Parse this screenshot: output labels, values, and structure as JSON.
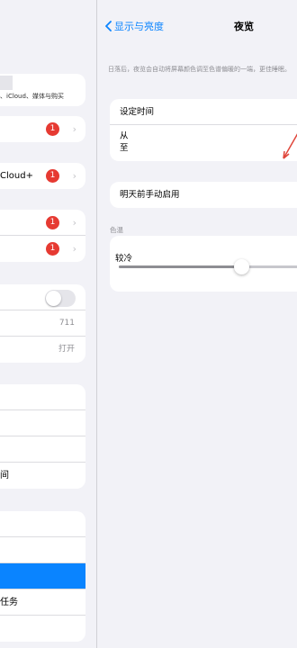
{
  "sidebar": {
    "profile_subtitle": "、iCloud、媒体与购买",
    "card2_rows": [
      {
        "label": "",
        "badge": "1"
      }
    ],
    "icloud_plus": {
      "label": "Cloud+",
      "badge": "1"
    },
    "update_rows": [
      {
        "label": "",
        "badge": "1"
      },
      {
        "label": "",
        "badge": "1"
      }
    ],
    "settings_rows": [
      {
        "label": "",
        "value": ""
      },
      {
        "label": "",
        "value": "711"
      },
      {
        "label": "",
        "value": "打开"
      }
    ],
    "section4_rows": [
      {
        "label": ""
      },
      {
        "label": ""
      },
      {
        "label": "间"
      }
    ],
    "section5_rows": [
      {
        "label": ""
      },
      {
        "label": ""
      },
      {
        "label": ""
      },
      {
        "label": "任务"
      },
      {
        "label": ""
      }
    ]
  },
  "detail": {
    "back_label": "显示与亮度",
    "title": "夜览",
    "description": "日落后，夜览会自动将屏幕颜色调至色谱偏暖的一端，更佳睡眠。",
    "schedule_label": "设定时间",
    "from_label": "从",
    "to_label": "至",
    "manual_label": "明天前手动启用",
    "color_temp_section": "色温",
    "color_temp_less_warm": "较冷",
    "color_temp_level": 0.65
  },
  "colors": {
    "accent": "#0a84ff",
    "badge": "#e63a32"
  },
  "icons": {
    "back": "chevron-left-icon",
    "disclosure": "chevron-right-icon"
  }
}
